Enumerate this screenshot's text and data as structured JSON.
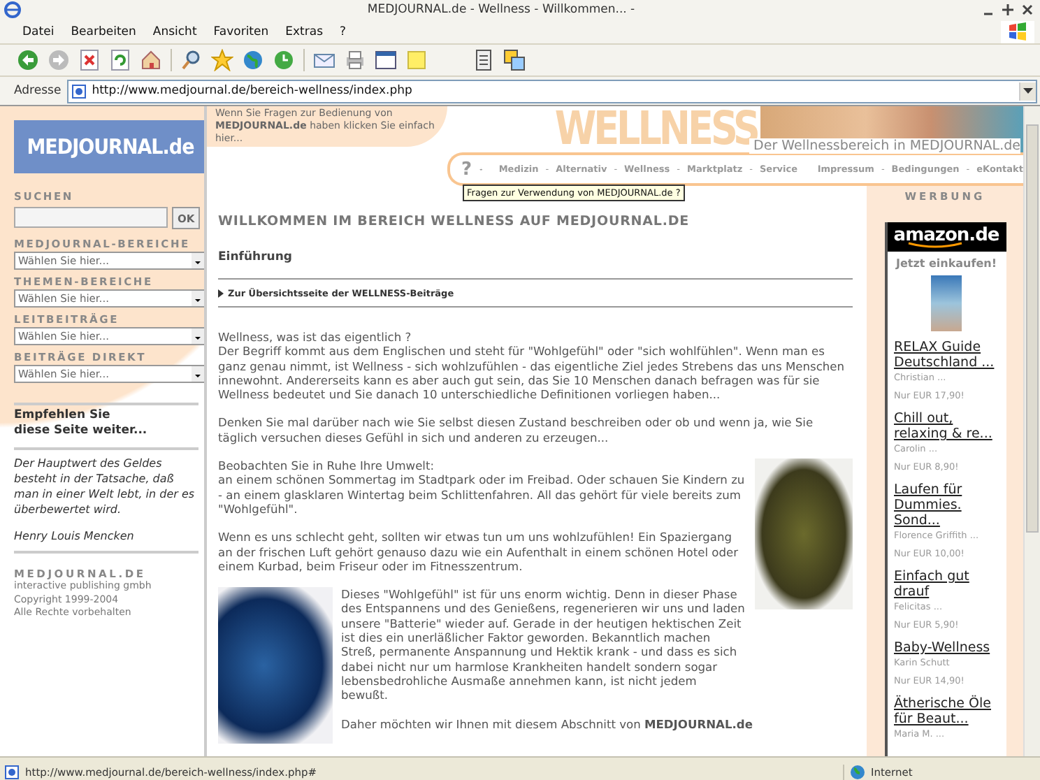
{
  "window": {
    "title": "MEDJOURNAL.de - Wellness - Willkommen... -"
  },
  "menu": [
    "Datei",
    "Bearbeiten",
    "Ansicht",
    "Favoriten",
    "Extras",
    "?"
  ],
  "address": {
    "label": "Adresse",
    "url": "http://www.medjournal.de/bereich-wellness/index.php"
  },
  "sidebar": {
    "logo": "MEDJOURNAL.de",
    "search_label": "SUCHEN",
    "search_button": "OK",
    "dropdowns": [
      {
        "label": "MEDJOURNAL-BEREICHE",
        "value": "Wählen Sie hier..."
      },
      {
        "label": "THEMEN-BEREICHE",
        "value": "Wählen Sie hier..."
      },
      {
        "label": "LEITBEITRÄGE",
        "value": "Wählen Sie hier..."
      },
      {
        "label": "BEITRÄGE DIREKT",
        "value": "Wählen Sie hier..."
      }
    ],
    "recommend": [
      "Empfehlen Sie",
      "diese Seite weiter..."
    ],
    "quote": "Der Hauptwert des Geldes besteht in der Tatsache, daß man in einer Welt lebt, in der es überbewertet wird.",
    "author": "Henry Louis Mencken",
    "footer_brand": "MEDJOURNAL.DE",
    "footer_lines": [
      "interactive publishing gmbh",
      "Copyright 1999-2004",
      "Alle Rechte vorbehalten"
    ]
  },
  "header": {
    "help_text": "Wenn Sie Fragen zur Bedienung von **MEDJOURNAL.de** haben klicken Sie einfach hier...",
    "banner_title": "WELLNESS",
    "subtitle": "Der Wellnessbereich in MEDJOURNAL.de",
    "help_icon": "?",
    "separator": "-",
    "nav_left": [
      "Medizin",
      "Alternativ",
      "Wellness",
      "Marktplatz",
      "Service"
    ],
    "nav_right": [
      "Impressum",
      "Bedingungen",
      "eKontakt"
    ],
    "tooltip": "Fragen zur Verwendung von MEDJOURNAL.de ?"
  },
  "main": {
    "heading": "WILLKOMMEN IM BEREICH WELLNESS AUF MEDJOURNAL.DE",
    "subheading": "Einführung",
    "link": "Zur Übersichtsseite der WELLNESS-Beiträge",
    "paragraphs": [
      {
        "lines": [
          "Wellness, was ist das eigentlich ?",
          "Der Begriff kommt aus dem Englischen und steht für \"Wohlgefühl\" oder \"sich wohlfühlen\". Wenn man es ganz genau nimmt, ist Wellness - sich wohlzufühlen - das eigentliche Ziel jedes Strebens das uns Menschen innewohnt. Andererseits kann es aber auch gut sein, das Sie 10 Menschen danach befragen was für sie Wellness bedeutet und Sie danach 10 unterschiedliche Definitionen vorliegen haben..."
        ]
      },
      {
        "lines": [
          "Denken Sie mal darüber nach wie Sie selbst diesen Zustand beschreiben oder ob und wenn ja, wie Sie täglich versuchen dieses Gefühl in sich und anderen zu erzeugen..."
        ]
      },
      {
        "lines": [
          "Beobachten Sie in Ruhe Ihre Umwelt:",
          "an einem schönen Sommertag im Stadtpark oder im Freibad. Oder schauen Sie Kindern zu - an einem glasklaren Wintertag beim Schlittenfahren. All das gehört für viele bereits zum \"Wohlgefühl\"."
        ]
      },
      {
        "lines": [
          "Wenn es uns schlecht geht, sollten wir etwas tun um uns wohlzufühlen! Ein Spaziergang an der frischen Luft gehört genauso dazu wie ein Aufenthalt in einem schönen Hotel oder einem Kurbad, beim Friseur oder im Fitnesszentrum."
        ]
      },
      {
        "lines": [
          "Dieses \"Wohlgefühl\" ist für uns enorm wichtig. Denn in dieser Phase des Entspannens und des Genießens, regenerieren wir uns und laden unsere \"Batterie\" wieder auf. Gerade in der heutigen hektischen Zeit ist dies ein unerläßlicher Faktor geworden. Bekanntlich machen Streß, permanente Anspannung und Hektik krank - und dass es sich dabei nicht nur um harmlose Krankheiten handelt sondern sogar lebensbedrohliche Ausmaße annehmen kann, ist nicht jedem bewußt."
        ]
      },
      {
        "lines": [
          "Daher möchten wir Ihnen mit diesem Abschnitt von **MEDJOURNAL.de**"
        ]
      }
    ]
  },
  "ads": {
    "title": "WERBUNG",
    "logo": "amazon.de",
    "tagline": "Jetzt einkaufen!",
    "items": [
      {
        "title": "RELAX Guide Deutschland ...",
        "author": "Christian ...",
        "price": "Nur EUR 17,90!"
      },
      {
        "title": "Chill out, relaxing & re...",
        "author": "Carolin ...",
        "price": "Nur EUR 8,90!"
      },
      {
        "title": "Laufen für Dummies. Sond...",
        "author": "Florence Griffith ...",
        "price": "Nur EUR 10,00!"
      },
      {
        "title": "Einfach gut drauf",
        "author": "Felicitas ...",
        "price": "Nur EUR 5,90!"
      },
      {
        "title": "Baby-Wellness",
        "author": "Karin Schutt",
        "price": "Nur EUR 14,90!"
      },
      {
        "title": "Ätherische Öle für Beaut...",
        "author": "Maria M. ..."
      }
    ]
  },
  "status": {
    "url": "http://www.medjournal.de/bereich-wellness/index.php#",
    "zone": "Internet"
  }
}
